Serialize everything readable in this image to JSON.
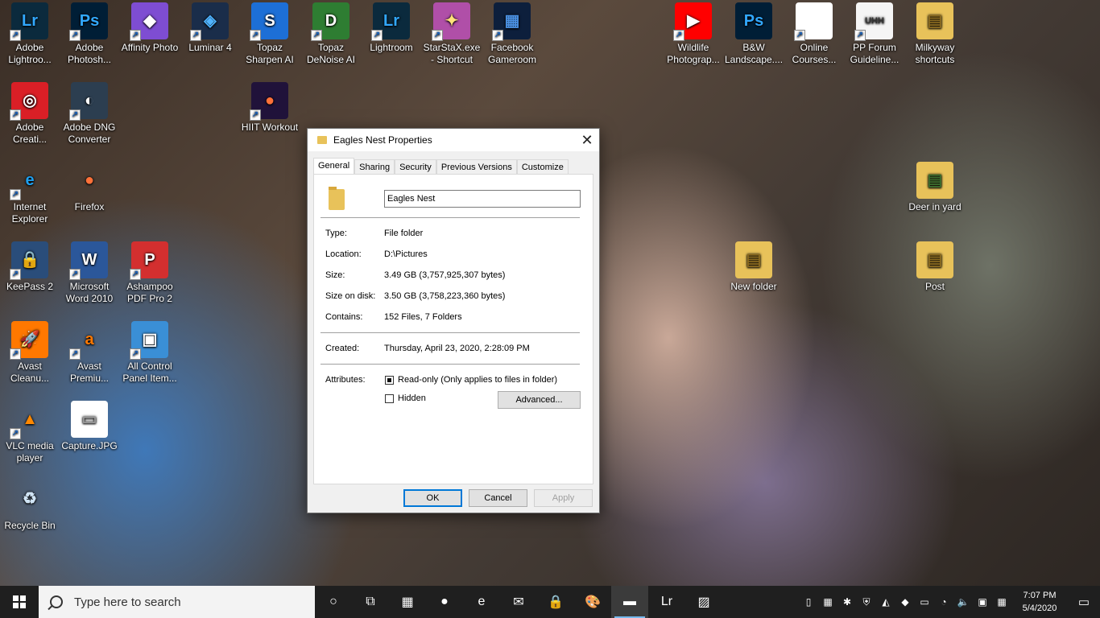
{
  "desktop": {
    "icons": [
      {
        "label": "Adobe Lightroo...",
        "glyph": "Lr",
        "bg": "#0b2a3d",
        "fg": "#31a8ff",
        "shortcut": true
      },
      {
        "label": "Adobe Photosh...",
        "glyph": "Ps",
        "bg": "#001e36",
        "fg": "#31a8ff",
        "shortcut": true
      },
      {
        "label": "Affinity Photo",
        "glyph": "◆",
        "bg": "#7e4dd2",
        "fg": "#ffffff",
        "shortcut": true
      },
      {
        "label": "Luminar 4",
        "glyph": "◈",
        "bg": "#1a2d4a",
        "fg": "#4fb3ff",
        "shortcut": true
      },
      {
        "label": "Topaz Sharpen AI",
        "glyph": "S",
        "bg": "#1d6fd6",
        "fg": "#ffffff",
        "shortcut": true
      },
      {
        "label": "Topaz DeNoise AI",
        "glyph": "D",
        "bg": "#2e7d32",
        "fg": "#ffffff",
        "shortcut": true
      },
      {
        "label": "Lightroom",
        "glyph": "Lr",
        "bg": "#0b2a3d",
        "fg": "#31a8ff",
        "shortcut": true
      },
      {
        "label": "StarStaX.exe - Shortcut",
        "glyph": "✦",
        "bg": "#b04fa8",
        "fg": "#ffe27a",
        "shortcut": true
      },
      {
        "label": "Facebook Gameroom",
        "glyph": "▦",
        "bg": "#0d1f3c",
        "fg": "#4a90e2",
        "shortcut": true
      },
      {
        "label": "Wildlife Photograp...",
        "glyph": "▶",
        "bg": "#ff0000",
        "fg": "#ffffff",
        "shortcut": true
      },
      {
        "label": "B&W Landscape....",
        "glyph": "Ps",
        "bg": "#001e36",
        "fg": "#31a8ff",
        "shortcut": false
      },
      {
        "label": "Online Courses...",
        "glyph": "",
        "bg": "#ffffff",
        "fg": "#000000",
        "shortcut": true
      },
      {
        "label": "PP Forum Guideline...",
        "glyph": "UHH",
        "bg": "#f5f5f5",
        "fg": "#333333",
        "shortcut": true
      },
      {
        "label": "Milkyway shortcuts",
        "glyph": "▤",
        "bg": "#e8c25a",
        "fg": "#8a6a20",
        "shortcut": false
      },
      {
        "label": "Adobe Creati...",
        "glyph": "◎",
        "bg": "#da1f26",
        "fg": "#ffffff",
        "shortcut": true
      },
      {
        "label": "Adobe DNG Converter",
        "glyph": "◐",
        "bg": "#2c3e50",
        "fg": "#ffffff",
        "shortcut": true
      },
      {
        "label": "HIIT Workout",
        "glyph": "●",
        "bg": "#20123a",
        "fg": "#ff7139",
        "shortcut": true
      },
      {
        "label": "Internet Explorer",
        "glyph": "e",
        "bg": "transparent",
        "fg": "#1ea0f0",
        "shortcut": true
      },
      {
        "label": "Firefox",
        "glyph": "●",
        "bg": "transparent",
        "fg": "#ff7139",
        "shortcut": false
      },
      {
        "label": "Deer in yard",
        "glyph": "▤",
        "bg": "#e8c25a",
        "fg": "#3b6b2e",
        "shortcut": false
      },
      {
        "label": "KeePass 2",
        "glyph": "🔒",
        "bg": "#2a4d7a",
        "fg": "#ffffff",
        "shortcut": true
      },
      {
        "label": "Microsoft Word 2010",
        "glyph": "W",
        "bg": "#2b579a",
        "fg": "#ffffff",
        "shortcut": true
      },
      {
        "label": "Ashampoo PDF Pro 2",
        "glyph": "P",
        "bg": "#d32f2f",
        "fg": "#ffffff",
        "shortcut": true
      },
      {
        "label": "New folder",
        "glyph": "▤",
        "bg": "#e8c25a",
        "fg": "#8a6a20",
        "shortcut": false
      },
      {
        "label": "Post",
        "glyph": "▤",
        "bg": "#e8c25a",
        "fg": "#8a6a20",
        "shortcut": false
      },
      {
        "label": "Avast Cleanu...",
        "glyph": "🚀",
        "bg": "#ff7800",
        "fg": "#ffffff",
        "shortcut": true
      },
      {
        "label": "Avast Premiu...",
        "glyph": "a",
        "bg": "transparent",
        "fg": "#ff7800",
        "shortcut": true
      },
      {
        "label": "All Control Panel Item...",
        "glyph": "▣",
        "bg": "#3a8fd6",
        "fg": "#ffffff",
        "shortcut": true
      },
      {
        "label": "VLC media player",
        "glyph": "▲",
        "bg": "transparent",
        "fg": "#ff8800",
        "shortcut": true
      },
      {
        "label": "Capture.JPG",
        "glyph": "▭",
        "bg": "#ffffff",
        "fg": "#999999",
        "shortcut": false
      },
      {
        "label": "Recycle Bin",
        "glyph": "♻",
        "bg": "transparent",
        "fg": "#d0e4f5",
        "shortcut": false
      }
    ]
  },
  "dialog": {
    "title": "Eagles Nest Properties",
    "close": "✕",
    "tabs": [
      "General",
      "Sharing",
      "Security",
      "Previous Versions",
      "Customize"
    ],
    "name_value": "Eagles Nest",
    "rows": [
      {
        "label": "Type:",
        "value": "File folder"
      },
      {
        "label": "Location:",
        "value": "D:\\Pictures"
      },
      {
        "label": "Size:",
        "value": "3.49 GB (3,757,925,307 bytes)"
      },
      {
        "label": "Size on disk:",
        "value": "3.50 GB (3,758,223,360 bytes)"
      },
      {
        "label": "Contains:",
        "value": "152 Files, 7 Folders"
      }
    ],
    "created_label": "Created:",
    "created_value": "Thursday, April 23, 2020, 2:28:09 PM",
    "attributes_label": "Attributes:",
    "readonly_label": "Read-only (Only applies to files in folder)",
    "readonly_checked": true,
    "hidden_label": "Hidden",
    "hidden_checked": false,
    "advanced_label": "Advanced...",
    "ok_label": "OK",
    "cancel_label": "Cancel",
    "apply_label": "Apply"
  },
  "taskbar": {
    "search_placeholder": "Type here to search",
    "pinned": [
      {
        "name": "task-view-icon",
        "glyph": "○"
      },
      {
        "name": "timeline-icon",
        "glyph": "⧉"
      },
      {
        "name": "calculator-icon",
        "glyph": "▦"
      },
      {
        "name": "firefox-icon",
        "glyph": "●"
      },
      {
        "name": "internet-explorer-icon",
        "glyph": "e"
      },
      {
        "name": "mail-icon",
        "glyph": "✉"
      },
      {
        "name": "keepass-icon",
        "glyph": "🔒"
      },
      {
        "name": "paint-icon",
        "glyph": "🎨"
      },
      {
        "name": "file-explorer-icon",
        "glyph": "▬"
      },
      {
        "name": "lightroom-icon",
        "glyph": "Lr"
      },
      {
        "name": "photos-icon",
        "glyph": "▨"
      }
    ],
    "tray": [
      "▯",
      "▦",
      "✱",
      "⛨",
      "◭",
      "◆",
      "▭",
      "◔",
      "🔈",
      "▣",
      "▦"
    ],
    "time": "7:07 PM",
    "date": "5/4/2020",
    "notification": "▭"
  }
}
